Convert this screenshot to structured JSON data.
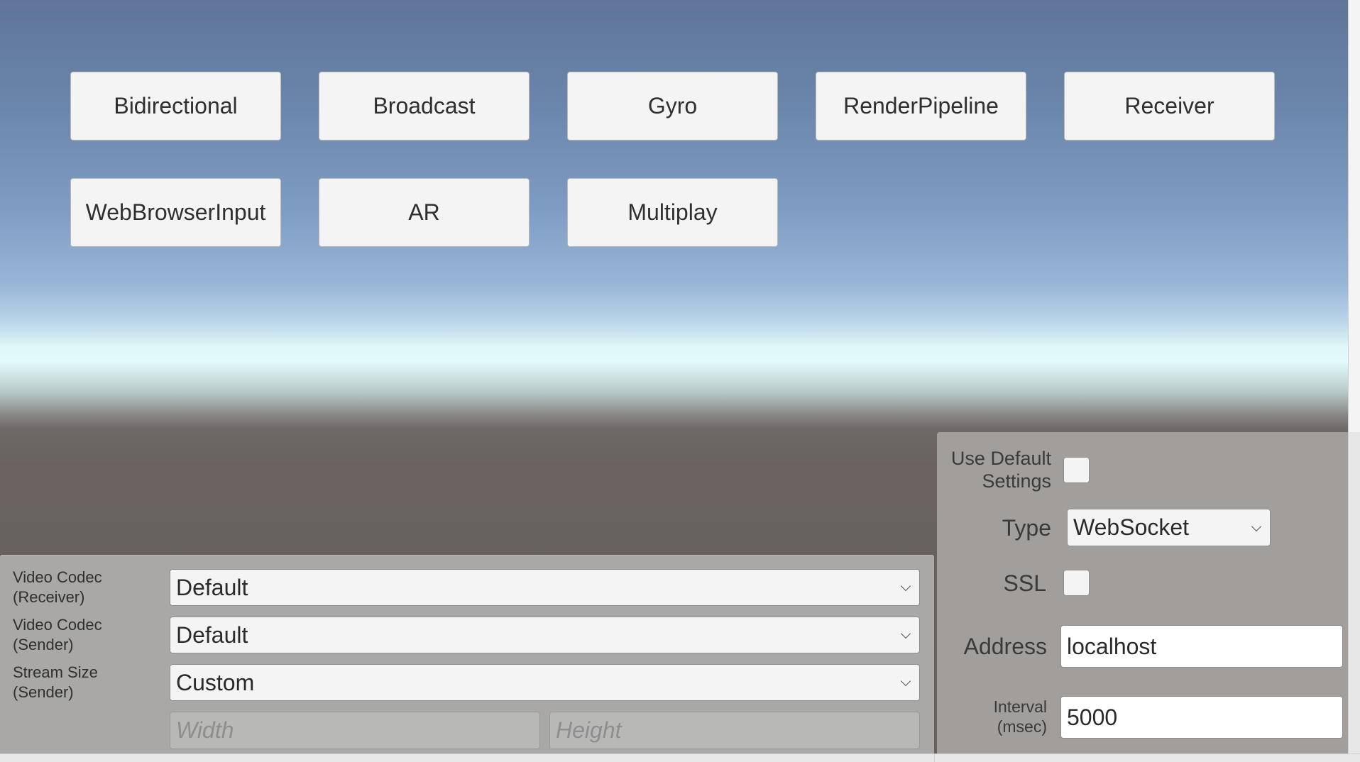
{
  "scene_buttons": [
    {
      "label": "Bidirectional"
    },
    {
      "label": "Broadcast"
    },
    {
      "label": "Gyro"
    },
    {
      "label": "RenderPipeline"
    },
    {
      "label": "Receiver"
    },
    {
      "label": "WebBrowserInput"
    },
    {
      "label": "AR"
    },
    {
      "label": "Multiplay"
    }
  ],
  "video_settings": {
    "codec_receiver": {
      "label_line1": "Video Codec",
      "label_line2": "(Receiver)",
      "value": "Default"
    },
    "codec_sender": {
      "label_line1": "Video Codec",
      "label_line2": "(Sender)",
      "value": "Default"
    },
    "stream_size": {
      "label_line1": "Stream Size",
      "label_line2": "(Sender)",
      "value": "Custom"
    },
    "width_placeholder": "Width",
    "height_placeholder": "Height"
  },
  "signaling_settings": {
    "use_default": {
      "label_line1": "Use Default",
      "label_line2": "Settings",
      "checked": false
    },
    "type": {
      "label": "Type",
      "value": "WebSocket"
    },
    "ssl": {
      "label": "SSL",
      "checked": false
    },
    "address": {
      "label": "Address",
      "value": "localhost"
    },
    "interval": {
      "label_line1": "Interval",
      "label_line2": "(msec)",
      "value": "5000"
    }
  }
}
